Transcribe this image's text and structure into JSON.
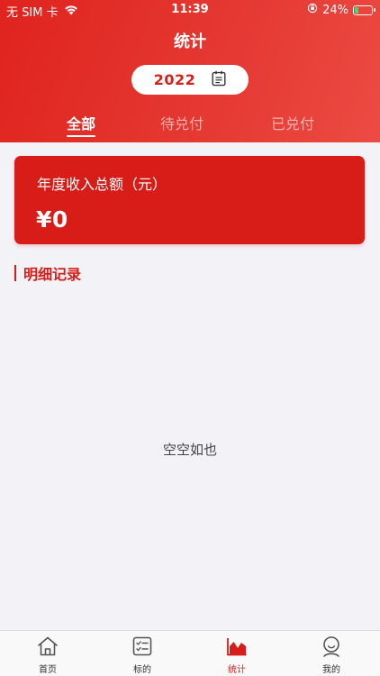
{
  "status_bar": {
    "carrier": "无 SIM 卡",
    "time": "11:39",
    "battery": "24%",
    "battery_level": 0.24
  },
  "header": {
    "title": "统计",
    "year": "2022"
  },
  "tabs": [
    {
      "label": "全部",
      "active": true
    },
    {
      "label": "待兑付",
      "active": false
    },
    {
      "label": "已兑付",
      "active": false
    }
  ],
  "income_card": {
    "label": "年度收入总额（元）",
    "value": "¥0"
  },
  "section": {
    "title": "明细记录"
  },
  "empty_state": {
    "text": "空空如也"
  },
  "tabbar": [
    {
      "label": "首页",
      "icon": "home-icon",
      "active": false
    },
    {
      "label": "标的",
      "icon": "checklist-icon",
      "active": false
    },
    {
      "label": "统计",
      "icon": "chart-icon",
      "active": true
    },
    {
      "label": "我的",
      "icon": "user-icon",
      "active": false
    }
  ],
  "colors": {
    "primary": "#d81d18",
    "background": "#f2f2f7",
    "battery_fill": "#4cd964"
  }
}
